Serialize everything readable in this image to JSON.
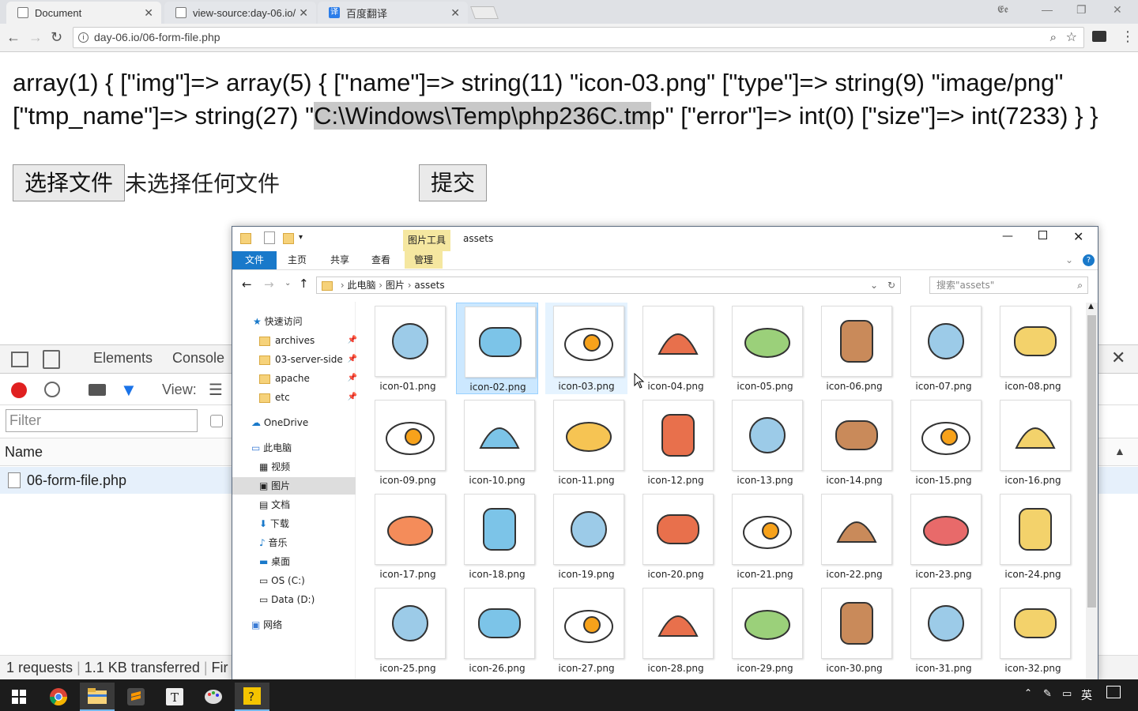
{
  "browser": {
    "tabs": [
      {
        "label": "Document",
        "icon": "page-icon"
      },
      {
        "label": "view-source:day-06.io/",
        "icon": "page-icon"
      },
      {
        "label": "百度翻译",
        "icon": "translate-icon",
        "icon_text": "译"
      }
    ],
    "url": "day-06.io/06-form-file.php",
    "window_label": "𝕰𝖊"
  },
  "page": {
    "dump_pre": "array(1) { [\"img\"]=> array(5) { [\"name\"]=> string(11) \"icon-03.png\" [\"type\"]=> string(9) \"image/png\" [\"tmp_name\"]=> string(27) \"",
    "dump_sel": "C:\\Windows\\Temp\\php236C.tm",
    "dump_post": "p\" [\"error\"]=> int(0) [\"size\"]=> int(7233) } }",
    "choose_file": "选择文件",
    "no_file": "未选择任何文件",
    "submit": "提交"
  },
  "devtools": {
    "tabs": [
      "Elements",
      "Console"
    ],
    "view_label": "View:",
    "filter_placeholder": "Filter",
    "col_name": "Name",
    "row_file": "06-form-file.php",
    "status_requests": "1 requests",
    "status_transferred": "1.1 KB transferred",
    "status_more": "Fir"
  },
  "explorer": {
    "tools_tab": "图片工具",
    "title": "assets",
    "ribbon": {
      "file": "文件",
      "home": "主页",
      "share": "共享",
      "view": "查看",
      "manage": "管理"
    },
    "crumbs": [
      "此电脑",
      "图片",
      "assets"
    ],
    "search_placeholder": "搜索\"assets\"",
    "nav": {
      "quick": "快速访问",
      "archives": "archives",
      "server": "03-server-side",
      "apache": "apache",
      "etc": "etc",
      "onedrive": "OneDrive",
      "pc": "此电脑",
      "video": "视频",
      "pictures": "图片",
      "docs": "文档",
      "downloads": "下载",
      "music": "音乐",
      "desktop": "桌面",
      "osc": "OS (C:)",
      "datad": "Data (D:)",
      "network": "网络"
    },
    "files": [
      "icon-01.png",
      "icon-02.png",
      "icon-03.png",
      "icon-04.png",
      "icon-05.png",
      "icon-06.png",
      "icon-07.png",
      "icon-08.png",
      "icon-09.png",
      "icon-10.png",
      "icon-11.png",
      "icon-12.png",
      "icon-13.png",
      "icon-14.png",
      "icon-15.png",
      "icon-16.png",
      "icon-17.png",
      "icon-18.png",
      "icon-19.png",
      "icon-20.png",
      "icon-21.png",
      "icon-22.png",
      "icon-23.png",
      "icon-24.png",
      "icon-25.png",
      "icon-26.png",
      "icon-27.png",
      "icon-28.png",
      "icon-29.png",
      "icon-30.png",
      "icon-31.png",
      "icon-32.png"
    ],
    "selected_file": "icon-02.png"
  },
  "taskbar": {
    "ime": "英"
  }
}
